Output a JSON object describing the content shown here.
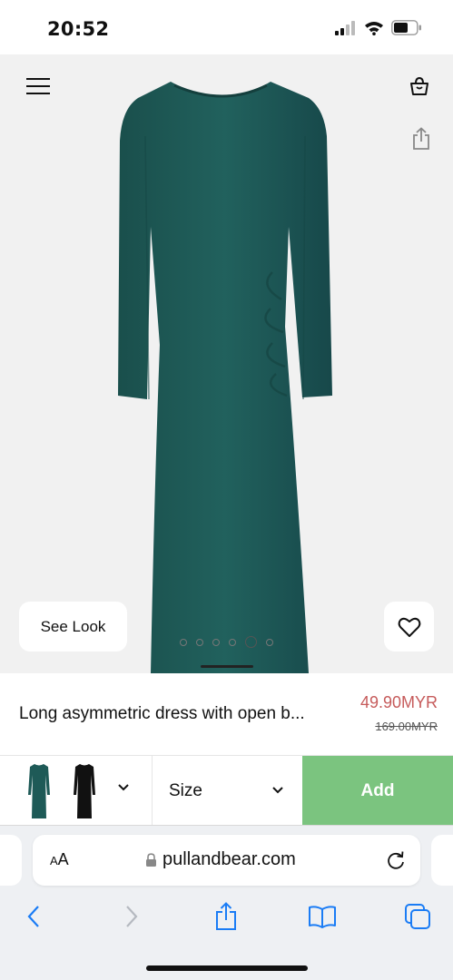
{
  "status_bar": {
    "time": "20:52",
    "icons": [
      "signal-icon",
      "wifi-icon",
      "battery-icon"
    ]
  },
  "header": {
    "icons": [
      "menu-icon",
      "bag-icon",
      "share-icon"
    ]
  },
  "hero": {
    "image": "green long-sleeve ruched maxi dress",
    "see_look_label": "See Look",
    "carousel": {
      "total": 6,
      "active_index": 4
    },
    "favorite_icon": "heart-icon"
  },
  "product": {
    "name": "Long asymmetric dress with open b...",
    "price": "49.90MYR",
    "original_price": "169.00MYR",
    "price_color": "#c65b5b"
  },
  "options": {
    "colors": [
      {
        "name": "dark green",
        "swatch": "#1e5a57"
      },
      {
        "name": "black",
        "swatch": "#111111"
      }
    ],
    "size_label": "Size",
    "add_label": "Add",
    "add_color": "#7bc47f"
  },
  "browser": {
    "aa_label_small": "A",
    "aa_label_big": "A",
    "url": "pullandbear.com",
    "toolbar_icons": [
      "back-icon",
      "forward-icon",
      "share-icon",
      "bookmarks-icon",
      "tabs-icon"
    ],
    "accent": "#1a7cf5"
  }
}
